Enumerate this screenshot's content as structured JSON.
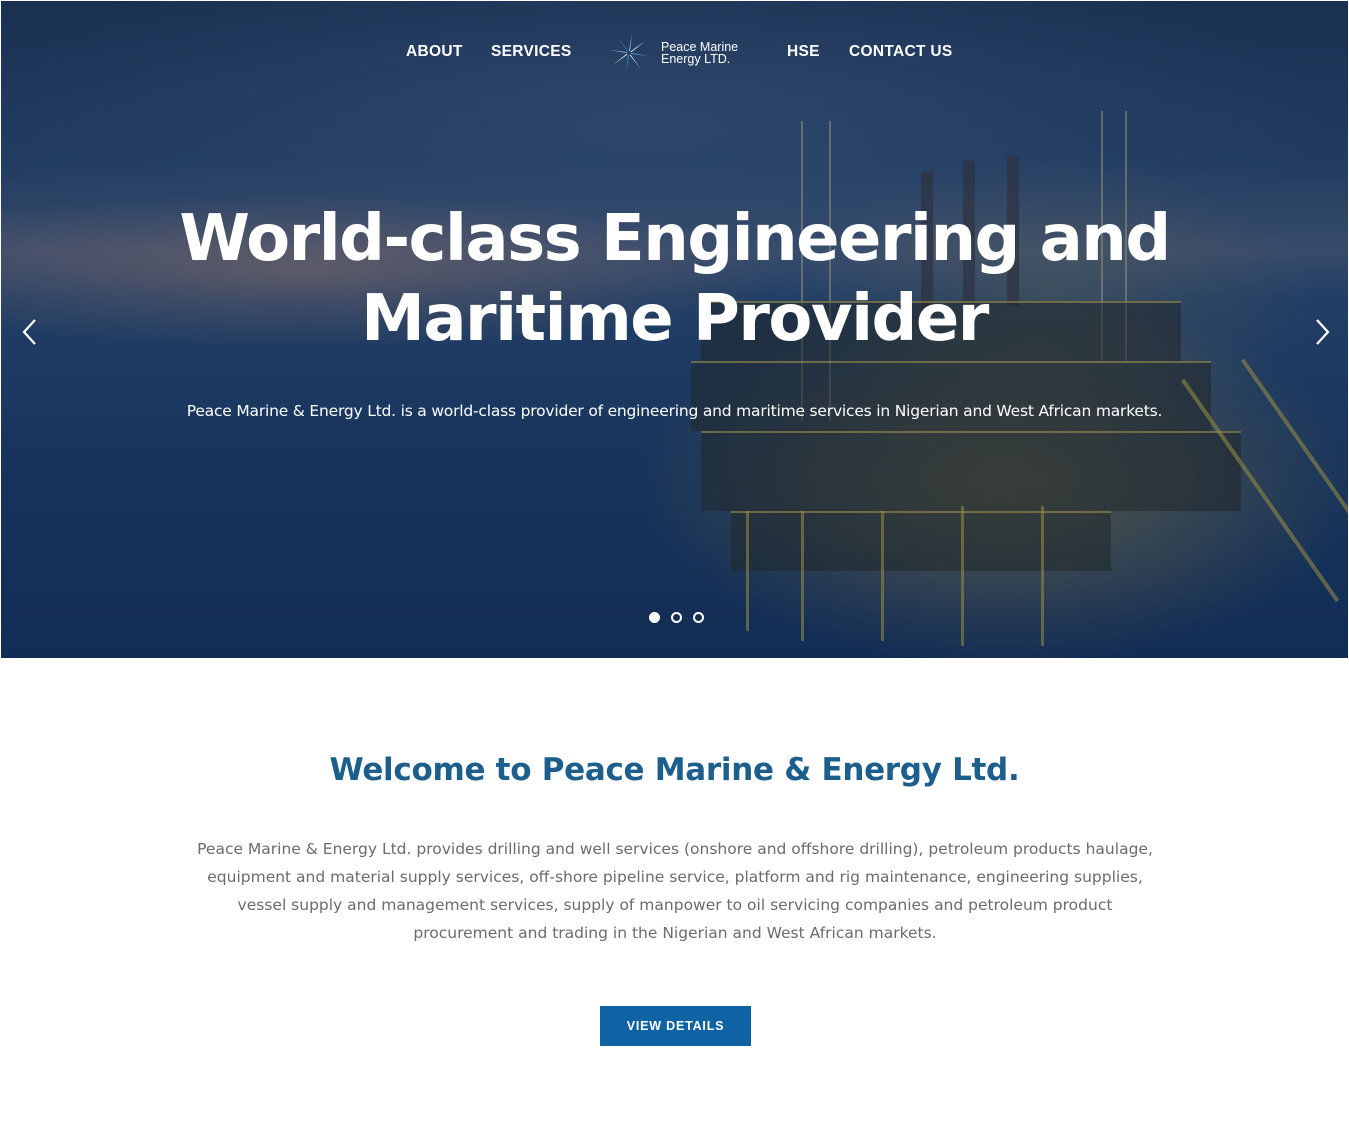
{
  "nav": {
    "about": "ABOUT",
    "services": "SERVICES",
    "hse": "HSE",
    "contact": "CONTACT US",
    "logo_line1": "Peace Marine",
    "logo_line2": "Energy LTD."
  },
  "hero": {
    "title_line1": "World-class Engineering and",
    "title_line2": "Maritime Provider",
    "subtitle": "Peace Marine & Energy Ltd. is a world-class provider of engineering and maritime services in Nigerian and West African markets.",
    "slides_total": 3,
    "active_slide": 1
  },
  "welcome": {
    "title": "Welcome to Peace Marine & Energy Ltd.",
    "body": "Peace Marine & Energy Ltd. provides drilling and well services (onshore and offshore drilling), petroleum products haulage, equipment and material supply services, off-shore pipeline service, platform and rig maintenance, engineering supplies, vessel supply and management services, supply of manpower to oil servicing companies and petroleum product procurement and trading in the Nigerian and West African markets.",
    "button": "VIEW DETAILS"
  },
  "colors": {
    "accent": "#1c5e8c",
    "button": "#0f62a3",
    "hero_overlay": "#163561"
  },
  "icons": [
    "logo-star-icon",
    "chevron-left-icon",
    "chevron-right-icon"
  ]
}
